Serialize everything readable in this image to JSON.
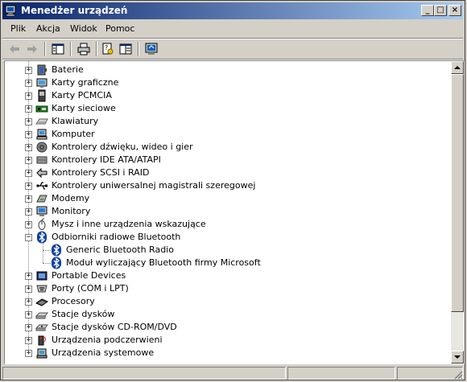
{
  "window": {
    "title": "Menedżer urządzeń"
  },
  "caption_buttons": {
    "minimize": "_",
    "maximize": "□",
    "close": "×"
  },
  "menu": [
    {
      "label": "Plik"
    },
    {
      "label": "Akcja"
    },
    {
      "label": "Widok"
    },
    {
      "label": "Pomoc"
    }
  ],
  "toolbar": [
    {
      "icon": "back-arrow-icon"
    },
    {
      "icon": "forward-arrow-icon"
    },
    {
      "icon": "show-hide-console-tree-icon"
    },
    {
      "icon": "print-icon"
    },
    {
      "icon": "properties-icon"
    },
    {
      "icon": "help-icon"
    },
    {
      "icon": "scan-hardware-icon"
    }
  ],
  "tree": [
    {
      "label": "Baterie",
      "icon": "battery-icon",
      "expanded": false
    },
    {
      "label": "Karty graficzne",
      "icon": "display-adapter-icon",
      "expanded": false
    },
    {
      "label": "Karty PCMCIA",
      "icon": "pcmcia-icon",
      "expanded": false
    },
    {
      "label": "Karty sieciowe",
      "icon": "network-adapter-icon",
      "expanded": false
    },
    {
      "label": "Klawiatury",
      "icon": "keyboard-icon",
      "expanded": false
    },
    {
      "label": "Komputer",
      "icon": "computer-icon",
      "expanded": false
    },
    {
      "label": "Kontrolery dźwięku, wideo i gier",
      "icon": "sound-controller-icon",
      "expanded": false
    },
    {
      "label": "Kontrolery IDE ATA/ATAPI",
      "icon": "ide-controller-icon",
      "expanded": false
    },
    {
      "label": "Kontrolery SCSI i RAID",
      "icon": "scsi-controller-icon",
      "expanded": false
    },
    {
      "label": "Kontrolery uniwersalnej magistrali szeregowej",
      "icon": "usb-icon",
      "expanded": false
    },
    {
      "label": "Modemy",
      "icon": "modem-icon",
      "expanded": false
    },
    {
      "label": "Monitory",
      "icon": "monitor-icon",
      "expanded": false
    },
    {
      "label": "Mysz i inne urządzenia wskazujące",
      "icon": "mouse-icon",
      "expanded": false
    },
    {
      "label": "Odbiorniki radiowe Bluetooth",
      "icon": "bluetooth-icon",
      "expanded": true,
      "children": [
        {
          "label": "Generic Bluetooth Radio",
          "icon": "bluetooth-icon"
        },
        {
          "label": "Moduł wyliczający Bluetooth firmy Microsoft",
          "icon": "bluetooth-icon"
        }
      ]
    },
    {
      "label": "Portable Devices",
      "icon": "portable-device-icon",
      "expanded": false
    },
    {
      "label": "Porty (COM i LPT)",
      "icon": "port-icon",
      "expanded": false
    },
    {
      "label": "Procesory",
      "icon": "processor-icon",
      "expanded": false
    },
    {
      "label": "Stacje dysków",
      "icon": "disk-drive-icon",
      "expanded": false
    },
    {
      "label": "Stacje dysków CD-ROM/DVD",
      "icon": "cdrom-icon",
      "expanded": false
    },
    {
      "label": "Urządzenia podczerwieni",
      "icon": "infrared-icon",
      "expanded": false
    },
    {
      "label": "Urządzenia systemowe",
      "icon": "system-device-icon",
      "expanded": false
    }
  ],
  "colors": {
    "titlebar_start": "#0a246a",
    "titlebar_end": "#a6caf0",
    "face": "#d4d0c8",
    "bluetooth": "#1040a0"
  },
  "scrollbar": {
    "position": 0.0,
    "visible_fraction": 0.86
  }
}
